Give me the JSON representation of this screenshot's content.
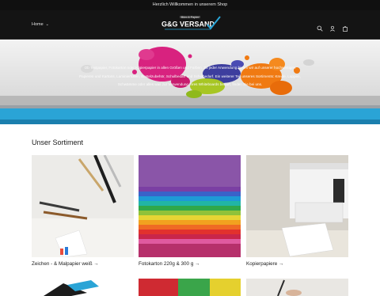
{
  "announcement": "Herzlich Willkommen in unserem Shop",
  "nav": {
    "home_label": "Home"
  },
  "logo": {
    "brand": "G&G VERSAND",
    "tagline": "Büro & Papier"
  },
  "icons": [
    "search-icon",
    "account-icon",
    "cart-icon"
  ],
  "hero": {
    "text": "Ob Textpapier, Fotokarton oder Kopierpapier in allen Größen und Farben. Zu jeder Anwendung bieten wir auf unserer hochwertigen Papieren und Kartons, Laminierfolien, Bastelzubehör, Schulbedarf und Schulbedarf. Ein weiterer Teil unseres Sortiments: Kreide, Lappen, Schwämme oder alles was zur Verwendung Ihres Whiteboards bedarf, finden Sie bei uns."
  },
  "colors": {
    "accent_blue": "#2aa4d6",
    "dark": "#141414"
  },
  "sortiment": {
    "title": "Unser Sortiment",
    "items": [
      {
        "label": "Zeichen - & Malpapier weiß →"
      },
      {
        "label": "Fotokarton 220g & 300 g →"
      },
      {
        "label": "Kopierpapiere →"
      }
    ]
  }
}
